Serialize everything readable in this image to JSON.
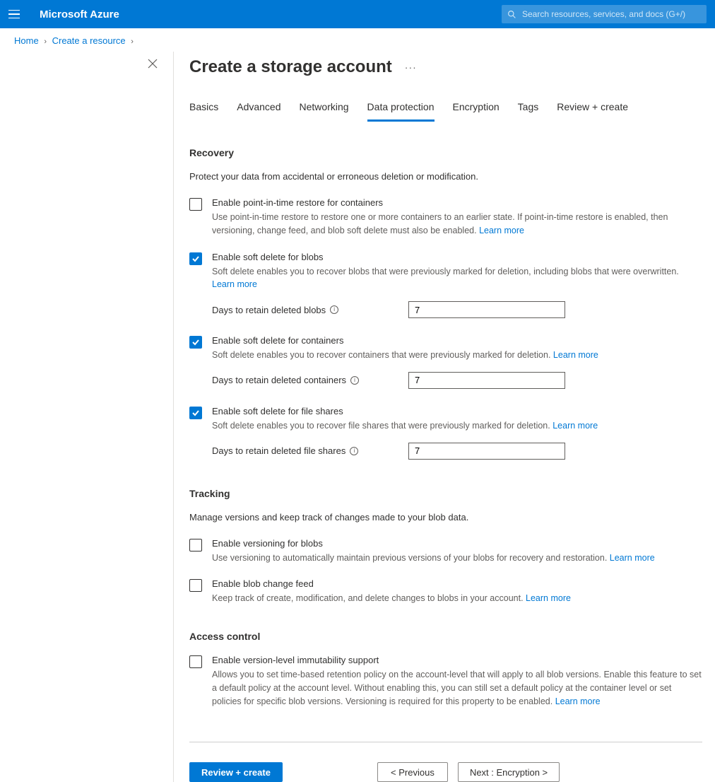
{
  "header": {
    "brand": "Microsoft Azure",
    "search_placeholder": "Search resources, services, and docs (G+/)"
  },
  "breadcrumb": {
    "items": [
      "Home",
      "Create a resource"
    ]
  },
  "page": {
    "title": "Create a storage account"
  },
  "tabs": [
    {
      "label": "Basics",
      "active": false
    },
    {
      "label": "Advanced",
      "active": false
    },
    {
      "label": "Networking",
      "active": false
    },
    {
      "label": "Data protection",
      "active": true
    },
    {
      "label": "Encryption",
      "active": false
    },
    {
      "label": "Tags",
      "active": false
    },
    {
      "label": "Review + create",
      "active": false
    }
  ],
  "recovery": {
    "title": "Recovery",
    "desc": "Protect your data from accidental or erroneous deletion or modification.",
    "options": {
      "pitr": {
        "label": "Enable point-in-time restore for containers",
        "desc": "Use point-in-time restore to restore one or more containers to an earlier state. If point-in-time restore is enabled, then versioning, change feed, and blob soft delete must also be enabled.",
        "learn": "Learn more"
      },
      "blob_soft": {
        "label": "Enable soft delete for blobs",
        "desc": "Soft delete enables you to recover blobs that were previously marked for deletion, including blobs that were overwritten.",
        "learn": "Learn more",
        "field_label": "Days to retain deleted blobs",
        "field_value": "7"
      },
      "container_soft": {
        "label": "Enable soft delete for containers",
        "desc": "Soft delete enables you to recover containers that were previously marked for deletion.",
        "learn": "Learn more",
        "field_label": "Days to retain deleted containers",
        "field_value": "7"
      },
      "fileshare_soft": {
        "label": "Enable soft delete for file shares",
        "desc": "Soft delete enables you to recover file shares that were previously marked for deletion.",
        "learn": "Learn more",
        "field_label": "Days to retain deleted file shares",
        "field_value": "7"
      }
    }
  },
  "tracking": {
    "title": "Tracking",
    "desc": "Manage versions and keep track of changes made to your blob data.",
    "options": {
      "versioning": {
        "label": "Enable versioning for blobs",
        "desc": "Use versioning to automatically maintain previous versions of your blobs for recovery and restoration.",
        "learn": "Learn more"
      },
      "change_feed": {
        "label": "Enable blob change feed",
        "desc": "Keep track of create, modification, and delete changes to blobs in your account.",
        "learn": "Learn more"
      }
    }
  },
  "access_control": {
    "title": "Access control",
    "options": {
      "immutability": {
        "label": "Enable version-level immutability support",
        "desc": "Allows you to set time-based retention policy on the account-level that will apply to all blob versions. Enable this feature to set a default policy at the account level. Without enabling this, you can still set a default policy at the container level or set policies for specific blob versions. Versioning is required for this property to be enabled.",
        "learn": "Learn more"
      }
    }
  },
  "footer": {
    "review": "Review + create",
    "previous": "< Previous",
    "next": "Next : Encryption >"
  }
}
